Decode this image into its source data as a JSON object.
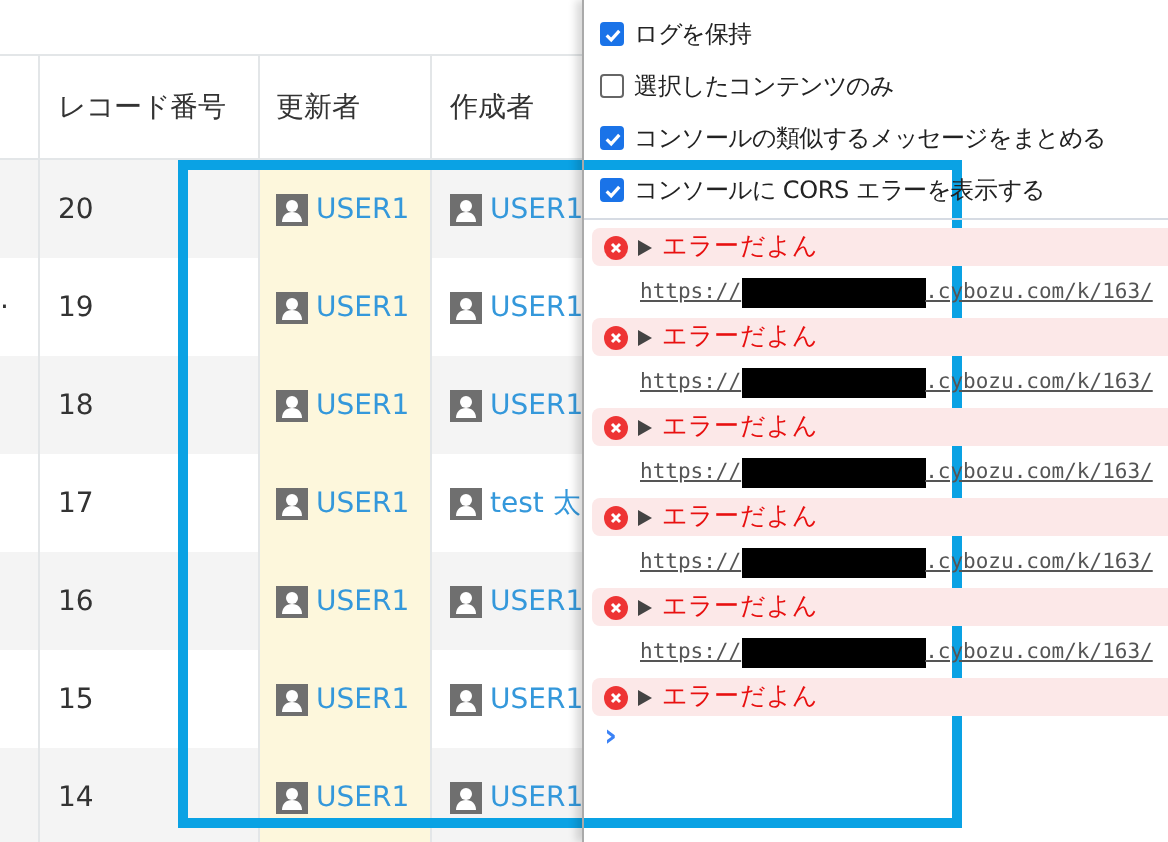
{
  "table": {
    "columns": [
      {},
      {
        "label": "レコード番号"
      },
      {
        "label": "更新者"
      },
      {
        "label": "作成者"
      }
    ],
    "rows": [
      {
        "record_number": "20",
        "updated_by": "USER1",
        "created_by": "USER1"
      },
      {
        "column_1": "·",
        "record_number": "19",
        "updated_by": "USER1",
        "created_by": "USER1"
      },
      {
        "record_number": "18",
        "updated_by": "USER1",
        "created_by": "USER1"
      },
      {
        "record_number": "17",
        "updated_by": "USER1",
        "created_by": "test 太"
      },
      {
        "record_number": "16",
        "updated_by": "USER1",
        "created_by": "USER1"
      },
      {
        "record_number": "15",
        "updated_by": "USER1",
        "created_by": "USER1"
      },
      {
        "record_number": "14",
        "updated_by": "USER1",
        "created_by": "USER1"
      }
    ]
  },
  "console": {
    "options": [
      {
        "label": "ログを保持",
        "checked": true
      },
      {
        "label": "選択したコンテンツのみ",
        "checked": false
      },
      {
        "label": "コンソールの類似するメッセージをまとめる",
        "checked": true
      },
      {
        "label": "コンソールに CORS エラーを表示する",
        "checked": true
      }
    ],
    "messages": [
      {
        "kind": "error",
        "text": "エラーだよん",
        "url_start": "https://",
        "url_end": ".cybozu.com/k/163/"
      },
      {
        "kind": "error",
        "text": "エラーだよん",
        "url_start": "https://",
        "url_end": ".cybozu.com/k/163/"
      },
      {
        "kind": "error",
        "text": "エラーだよん",
        "url_start": "https://",
        "url_end": ".cybozu.com/k/163/"
      },
      {
        "kind": "error",
        "text": "エラーだよん",
        "url_start": "https://",
        "url_end": ".cybozu.com/k/163/"
      },
      {
        "kind": "error",
        "text": "エラーだよん",
        "url_start": "https://",
        "url_end": ".cybozu.com/k/163/"
      },
      {
        "kind": "error",
        "text": "エラーだよん"
      }
    ],
    "prompt": "›"
  }
}
